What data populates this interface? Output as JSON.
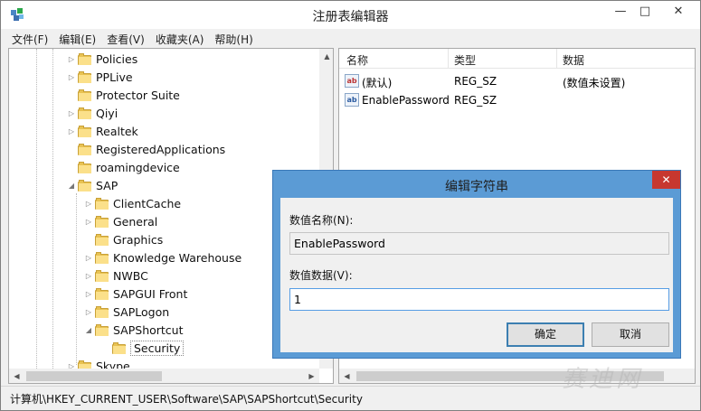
{
  "window": {
    "title": "注册表编辑器",
    "controls": {
      "minimize": "—",
      "maximize": "□",
      "close": "✕"
    }
  },
  "menu": [
    "文件(F)",
    "编辑(E)",
    "查看(V)",
    "收藏夹(A)",
    "帮助(H)"
  ],
  "tree": {
    "items": [
      {
        "label": "Policies",
        "expander": "▷",
        "level": 0
      },
      {
        "label": "PPLive",
        "expander": "▷",
        "level": 0
      },
      {
        "label": "Protector Suite",
        "expander": "",
        "level": 0
      },
      {
        "label": "Qiyi",
        "expander": "▷",
        "level": 0
      },
      {
        "label": "Realtek",
        "expander": "▷",
        "level": 0
      },
      {
        "label": "RegisteredApplications",
        "expander": "",
        "level": 0
      },
      {
        "label": "roamingdevice",
        "expander": "",
        "level": 0
      },
      {
        "label": "SAP",
        "expander": "◢",
        "level": 0
      },
      {
        "label": "ClientCache",
        "expander": "▷",
        "level": 1
      },
      {
        "label": "General",
        "expander": "▷",
        "level": 1
      },
      {
        "label": "Graphics",
        "expander": "",
        "level": 1
      },
      {
        "label": "Knowledge Warehouse",
        "expander": "▷",
        "level": 1
      },
      {
        "label": "NWBC",
        "expander": "▷",
        "level": 1
      },
      {
        "label": "SAPGUI Front",
        "expander": "▷",
        "level": 1
      },
      {
        "label": "SAPLogon",
        "expander": "▷",
        "level": 1
      },
      {
        "label": "SAPShortcut",
        "expander": "◢",
        "level": 1
      },
      {
        "label": "Security",
        "expander": "",
        "level": 2,
        "selected": true
      },
      {
        "label": "Skype",
        "expander": "▷",
        "level": 0
      }
    ]
  },
  "list": {
    "columns": [
      "名称",
      "类型",
      "数据"
    ],
    "rows": [
      {
        "icon": "ab",
        "name": "(默认)",
        "type": "REG_SZ",
        "data": "(数值未设置)"
      },
      {
        "icon": "ab",
        "name": "EnablePassword",
        "type": "REG_SZ",
        "data": ""
      }
    ]
  },
  "status": {
    "path": "计算机\\HKEY_CURRENT_USER\\Software\\SAP\\SAPShortcut\\Security"
  },
  "watermark": "赛迪网",
  "dialog": {
    "title": "编辑字符串",
    "close": "✕",
    "name_label": "数值名称(N):",
    "name_value": "EnablePassword",
    "data_label": "数值数据(V):",
    "data_value": "1",
    "ok_label": "确定",
    "cancel_label": "取消"
  },
  "colors": {
    "dialog_frame": "#5b9bd5",
    "close_button": "#c7372f",
    "folder": "#e8c252"
  },
  "icons": [
    "registry-editor-icon",
    "folder-icon",
    "string-value-icon",
    "scroll-arrow-icon"
  ]
}
